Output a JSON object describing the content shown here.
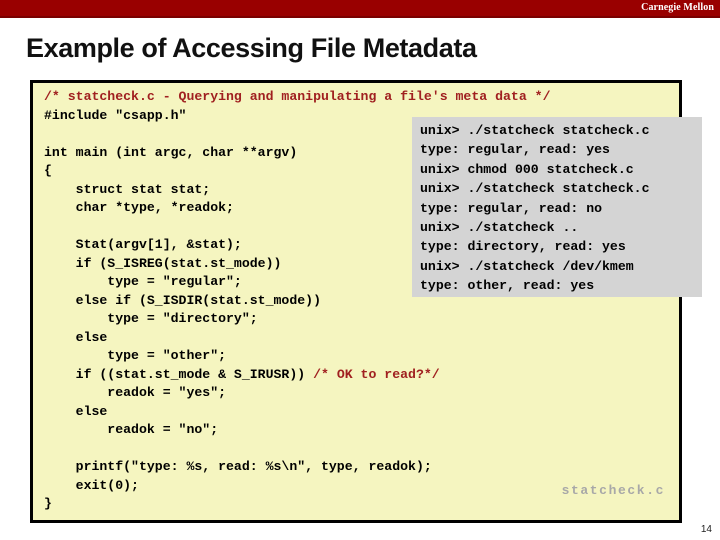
{
  "brand": {
    "wordmark": "Carnegie Mellon",
    "bar_color": "#990000"
  },
  "slide": {
    "title": "Example of Accessing File Metadata",
    "page_number": "14",
    "watermark": "statcheck.c"
  },
  "code_panel": {
    "background_color": "#f5f5c0",
    "border_color": "#000000",
    "comment_color": "#a02020",
    "lines": [
      [
        {
          "t": "/* statcheck.c - Querying and manipulating a file's meta data */",
          "c": "cmt"
        }
      ],
      [
        {
          "t": "#include \"csapp.h\"",
          "c": ""
        }
      ],
      [
        {
          "t": "",
          "c": ""
        }
      ],
      [
        {
          "t": "int main (int argc, char **argv)",
          "c": ""
        }
      ],
      [
        {
          "t": "{",
          "c": ""
        }
      ],
      [
        {
          "t": "    struct stat stat;",
          "c": ""
        }
      ],
      [
        {
          "t": "    char *type, *readok;",
          "c": ""
        }
      ],
      [
        {
          "t": "",
          "c": ""
        }
      ],
      [
        {
          "t": "    Stat(argv[1], &stat);",
          "c": ""
        }
      ],
      [
        {
          "t": "    if (S_ISREG(stat.st_mode))",
          "c": ""
        }
      ],
      [
        {
          "t": "        type = \"regular\";",
          "c": ""
        }
      ],
      [
        {
          "t": "    else if (S_ISDIR(stat.st_mode))",
          "c": ""
        }
      ],
      [
        {
          "t": "        type = \"directory\";",
          "c": ""
        }
      ],
      [
        {
          "t": "    else",
          "c": ""
        }
      ],
      [
        {
          "t": "        type = \"other\";",
          "c": ""
        }
      ],
      [
        {
          "t": "    if ((stat.st_mode & S_IRUSR)) ",
          "c": ""
        },
        {
          "t": "/* OK to read?*/",
          "c": "cmt"
        }
      ],
      [
        {
          "t": "        readok = \"yes\";",
          "c": ""
        }
      ],
      [
        {
          "t": "    else",
          "c": ""
        }
      ],
      [
        {
          "t": "        readok = \"no\";",
          "c": ""
        }
      ],
      [
        {
          "t": "",
          "c": ""
        }
      ],
      [
        {
          "t": "    printf(\"type: %s, read: %s\\n\", type, readok);",
          "c": ""
        }
      ],
      [
        {
          "t": "    exit(0);",
          "c": ""
        }
      ],
      [
        {
          "t": "}",
          "c": ""
        }
      ]
    ]
  },
  "terminal_panel": {
    "background_color": "#d4d4d4",
    "lines": [
      "unix> ./statcheck statcheck.c",
      "type: regular, read: yes",
      "unix> chmod 000 statcheck.c",
      "unix> ./statcheck statcheck.c",
      "type: regular, read: no",
      "unix> ./statcheck ..",
      "type: directory, read: yes",
      "unix> ./statcheck /dev/kmem",
      "type: other, read: yes"
    ]
  }
}
